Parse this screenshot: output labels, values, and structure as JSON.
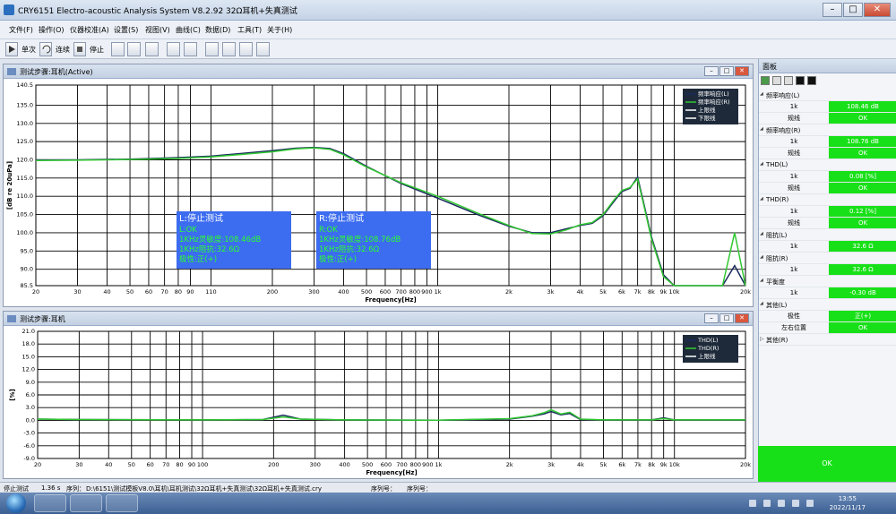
{
  "app": {
    "title": "CRY6151 Electro-acoustic Analysis System  V8.2.92 32Ω耳机+失真测试"
  },
  "menu": [
    "文件(F)",
    "操作(O)",
    "仪器校准(A)",
    "设置(S)",
    "视图(V)",
    "曲线(C)",
    "数据(D)",
    "工具(T)",
    "关于(H)"
  ],
  "toolbar": {
    "single": "单次",
    "continuous": "连续",
    "stop": "停止"
  },
  "top_panel": {
    "title": "测试步骤:耳机(Active)",
    "box_L": {
      "title": "L:停止测试",
      "lines": [
        "L:OK",
        "1KHz灵敏度:108.46dB",
        "1KHz阻抗:32.6Ω",
        "极性:正(+)"
      ]
    },
    "box_R": {
      "title": "R:停止测试",
      "lines": [
        "R:OK",
        "1KHz灵敏度:108.76dB",
        "1KHz阻抗:32.6Ω",
        "极性:正(+)"
      ]
    }
  },
  "bottom_panel": {
    "title": "测试步骤:耳机"
  },
  "colors": {
    "curve_L": "#1a2a5c",
    "curve_R": "#32c832",
    "limit": "#ffffff",
    "ok_green": "#18e018",
    "box_blue": "#3c6cf0",
    "box_text": "#2cff2c"
  },
  "chart_data": [
    {
      "type": "line",
      "title": "",
      "xlabel": "Frequency[Hz]",
      "ylabel": "[dB re 20uPa]",
      "xscale": "log",
      "xlim": [
        20,
        20000
      ],
      "ylim": [
        85.5,
        140.5
      ],
      "xticks": [
        "20",
        "30",
        "40",
        "50",
        "60",
        "70",
        "80",
        "90",
        "110",
        "200",
        "300",
        "400",
        "500",
        "600",
        "700",
        "800",
        "900",
        "1k",
        "2k",
        "3k",
        "4k",
        "5k",
        "6k",
        "7k",
        "8k",
        "9k",
        "10k",
        "20k"
      ],
      "yticks": [
        "140.5",
        "135.0",
        "130.0",
        "125.0",
        "120.0",
        "115.0",
        "110.0",
        "105.0",
        "100.0",
        "95.0",
        "90.0",
        "85.5"
      ],
      "legend": [
        "频率响应(L)",
        "频率响应(R)",
        "上限线",
        "下限线"
      ],
      "legend_position": "top-right",
      "grid": true,
      "series": [
        {
          "name": "频率响应(L)",
          "x": [
            20,
            30,
            50,
            80,
            110,
            150,
            200,
            250,
            300,
            350,
            400,
            500,
            700,
            1000,
            1500,
            2000,
            2500,
            3000,
            3500,
            4000,
            4500,
            5000,
            5500,
            6000,
            6500,
            7000,
            7500,
            8000,
            9000,
            10000,
            16000,
            18000,
            20000
          ],
          "y": [
            120,
            120,
            120.2,
            120.6,
            121,
            121.8,
            122.5,
            123.2,
            123.4,
            123.1,
            121.7,
            118.2,
            113.5,
            109.5,
            104.8,
            101.8,
            100,
            100,
            101.1,
            102,
            102.6,
            104.7,
            108.2,
            111.3,
            112.2,
            115.3,
            107,
            99,
            88.5,
            85.5,
            85.5,
            91,
            85.5
          ]
        },
        {
          "name": "频率响应(R)",
          "x": [
            20,
            30,
            50,
            80,
            110,
            150,
            200,
            250,
            300,
            350,
            400,
            500,
            700,
            1000,
            1500,
            2000,
            2500,
            3000,
            3500,
            4000,
            4500,
            5000,
            5500,
            6000,
            6500,
            7000,
            7500,
            8000,
            9000,
            10000,
            16000,
            18000,
            20000
          ],
          "y": [
            119.8,
            119.9,
            120.1,
            120.4,
            120.8,
            121.5,
            122.2,
            123,
            123.3,
            122.9,
            121.4,
            118,
            113.7,
            110,
            105.2,
            102,
            99.8,
            99.7,
            100.8,
            102.2,
            102.8,
            105,
            108.6,
            111.6,
            112.4,
            114.8,
            106.5,
            98.5,
            88,
            85.5,
            85.5,
            100,
            85.5
          ]
        }
      ]
    },
    {
      "type": "line",
      "title": "",
      "xlabel": "Frequency[Hz]",
      "ylabel": "[%]",
      "xscale": "log",
      "xlim": [
        20,
        20000
      ],
      "ylim": [
        -9,
        21
      ],
      "xticks": [
        "20",
        "30",
        "40",
        "50",
        "60",
        "70",
        "80",
        "90",
        "100",
        "200",
        "300",
        "400",
        "500",
        "600",
        "700",
        "800",
        "900",
        "1k",
        "2k",
        "3k",
        "4k",
        "5k",
        "6k",
        "7k",
        "8k",
        "9k",
        "10k",
        "20k"
      ],
      "yticks": [
        "21.0",
        "18.0",
        "15.0",
        "12.0",
        "9.0",
        "6.0",
        "3.0",
        "0.0",
        "-3.0",
        "-6.0",
        "-9.0"
      ],
      "legend": [
        "THD(L)",
        "THD(R)",
        "上限线"
      ],
      "legend_position": "top-right",
      "grid": true,
      "series": [
        {
          "name": "THD(L)",
          "x": [
            20,
            30,
            100,
            180,
            220,
            260,
            400,
            1000,
            2000,
            2500,
            2800,
            3000,
            3300,
            3600,
            4000,
            5000,
            8000,
            9000,
            10000,
            20000
          ],
          "y": [
            0.3,
            0.2,
            0.1,
            0.2,
            1.2,
            0.3,
            0.1,
            0.05,
            0.3,
            1,
            1.5,
            2.1,
            1.3,
            1.6,
            0.2,
            0.1,
            0.1,
            0.6,
            0.1,
            0.1
          ]
        },
        {
          "name": "THD(R)",
          "x": [
            20,
            30,
            100,
            180,
            220,
            260,
            400,
            1000,
            2000,
            2500,
            2800,
            3000,
            3300,
            3600,
            4000,
            5000,
            8000,
            9000,
            10000,
            20000
          ],
          "y": [
            0.3,
            0.2,
            0.1,
            0.2,
            0.8,
            0.3,
            0.1,
            0.05,
            0.4,
            1.1,
            1.8,
            2.5,
            1.5,
            1.9,
            0.3,
            0.1,
            0.1,
            0.4,
            0.1,
            0.1
          ]
        }
      ]
    }
  ],
  "side_panel": {
    "title": "面板",
    "rows": [
      {
        "cat": "频率响应(L)"
      },
      {
        "k": "1k",
        "v": "108.46 dB"
      },
      {
        "k": "规线",
        "v": "OK"
      },
      {
        "cat": "频率响应(R)"
      },
      {
        "k": "1k",
        "v": "108.76 dB"
      },
      {
        "k": "规线",
        "v": "OK"
      },
      {
        "cat": "THD(L)"
      },
      {
        "k": "1k",
        "v": "0.08 [%]"
      },
      {
        "k": "规线",
        "v": "OK"
      },
      {
        "cat": "THD(R)"
      },
      {
        "k": "1k",
        "v": "0.12 [%]"
      },
      {
        "k": "规线",
        "v": "OK"
      },
      {
        "cat": "阻抗(L)"
      },
      {
        "k": "1k",
        "v": "32.6 Ω"
      },
      {
        "cat": "阻抗(R)"
      },
      {
        "k": "1k",
        "v": "32.6 Ω"
      },
      {
        "cat": "平衡度"
      },
      {
        "k": "1k",
        "v": "-0.30 dB"
      },
      {
        "cat": "其他(L)"
      },
      {
        "k": "极性",
        "v": "正(+)"
      },
      {
        "k": "左右位置",
        "v": "OK"
      },
      {
        "cat": "其他(R)",
        "coll": true
      }
    ],
    "ok": "OK"
  },
  "status": {
    "state": "停止测试",
    "time": "1.36 s",
    "seq_label": "序列：",
    "path": "D:\\6151\\测试模板V8.0\\耳机\\耳机测试\\32Ω耳机+失真测试\\32Ω耳机+失真测试.cry",
    "serial1": "序列号：",
    "serial2": "序列号："
  },
  "taskbar": {
    "time": "13:55",
    "date": "2022/11/17"
  }
}
